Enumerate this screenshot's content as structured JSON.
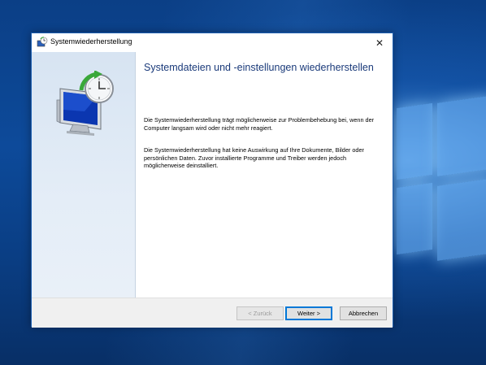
{
  "dialog": {
    "title": "Systemwiederherstellung",
    "close_glyph": "✕",
    "heading": "Systemdateien und -einstellungen wiederherstellen",
    "paragraph1": "Die Systemwiederherstellung trägt möglicherweise zur Problembehebung bei, wenn der Computer langsam wird oder nicht mehr reagiert.",
    "paragraph2": "Die Systemwiederherstellung hat keine Auswirkung auf Ihre Dokumente, Bilder oder persönlichen Daten. Zuvor installierte Programme und Treiber werden jedoch möglicherweise deinstalliert."
  },
  "buttons": {
    "back": "< Zurück",
    "next": "Weiter >",
    "cancel": "Abbrechen"
  },
  "icons": {
    "title": "system-restore-icon",
    "hero": "system-restore-clock-monitor-icon"
  },
  "colors": {
    "heading": "#1a3a7a",
    "accent": "#0078d7",
    "desktop": "#0b3f86"
  }
}
